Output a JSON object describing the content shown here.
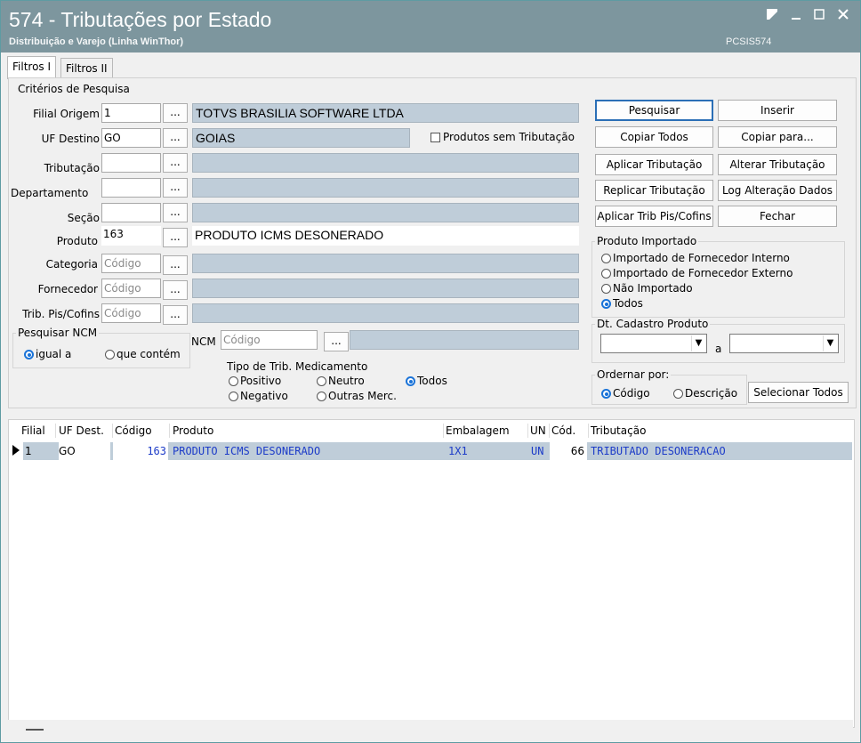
{
  "window": {
    "title": "574 - Tributações por Estado",
    "subtitle": "Distribuição e Varejo (Linha WinThor)",
    "code": "PCSIS574",
    "controls": [
      "restore",
      "minimize",
      "maximize",
      "close"
    ],
    "title_bg_color": "#7d969e"
  },
  "tabs": [
    "Filtros I",
    "Filtros II"
  ],
  "active_tab": "Filtros I",
  "criteria": {
    "group_title": "Critérios de Pesquisa",
    "filial_origem": {
      "label": "Filial Origem",
      "value": "1",
      "desc": "TOTVS BRASILIA SOFTWARE LTDA"
    },
    "uf_destino": {
      "label": "UF Destino",
      "value": "GO",
      "desc": "GOIAS"
    },
    "produtos_sem_tributacao": {
      "label": "Produtos sem Tributação",
      "checked": false
    },
    "tributacao": {
      "label": "Tributação",
      "value": "",
      "desc": ""
    },
    "departamento": {
      "label": "Departamento",
      "value": "",
      "desc": ""
    },
    "secao": {
      "label": "Seção",
      "value": "",
      "desc": ""
    },
    "produto": {
      "label": "Produto",
      "value": "163",
      "desc": "PRODUTO ICMS DESONERADO"
    },
    "categoria": {
      "label": "Categoria",
      "placeholder": "Código",
      "desc": ""
    },
    "fornecedor": {
      "label": "Fornecedor",
      "placeholder": "Código",
      "desc": ""
    },
    "trib_pis_cofins": {
      "label": "Trib. Pis/Cofins",
      "placeholder": "Código",
      "desc": ""
    },
    "dots_label": "...",
    "pesquisar_ncm": {
      "title": "Pesquisar NCM",
      "options": [
        "igual a",
        "que contém"
      ],
      "selected": "igual a"
    },
    "ncm": {
      "label": "NCM",
      "placeholder": "Código",
      "desc": ""
    },
    "tipo_trib_medicamento": {
      "title": "Tipo de Trib. Medicamento",
      "options": [
        "Positivo",
        "Neutro",
        "Todos",
        "Negativo",
        "Outras Merc."
      ],
      "selected": "Todos"
    }
  },
  "buttons": {
    "pesquisar": "Pesquisar",
    "inserir": "Inserir",
    "copiar_todos": "Copiar Todos",
    "copiar_para": "Copiar para...",
    "aplicar_tributacao": "Aplicar Tributação",
    "alterar_tributacao": "Alterar Tributação",
    "replicar_tributacao": "Replicar Tributação",
    "log_alteracao": "Log Alteração Dados",
    "aplicar_trib_pis": "Aplicar Trib Pis/Cofins",
    "fechar": "Fechar",
    "selecionar_todos": "Selecionar Todos"
  },
  "produto_importado": {
    "title": "Produto Importado",
    "options": [
      "Importado de Fornecedor Interno",
      "Importado de Fornecedor Externo",
      "Não Importado",
      "Todos"
    ],
    "selected": "Todos"
  },
  "dt_cadastro": {
    "title": "Dt. Cadastro Produto",
    "from": "",
    "separator": "a",
    "to": ""
  },
  "ordenar": {
    "title": "Ordernar por:",
    "options": [
      "Código",
      "Descrição"
    ],
    "selected": "Código"
  },
  "grid": {
    "columns": [
      "Filial",
      "UF Dest.",
      "Código",
      "Produto",
      "Embalagem",
      "UN",
      "Cód.",
      "Tributação"
    ],
    "rows": [
      {
        "filial": "1",
        "uf": "GO",
        "codigo": "163",
        "produto": "PRODUTO ICMS DESONERADO",
        "embalagem": "1X1",
        "un": "UN",
        "cod": "66",
        "tributacao": "TRIBUTADO DESONERACAO"
      }
    ],
    "selected_row_color": "#bfcdd9"
  }
}
